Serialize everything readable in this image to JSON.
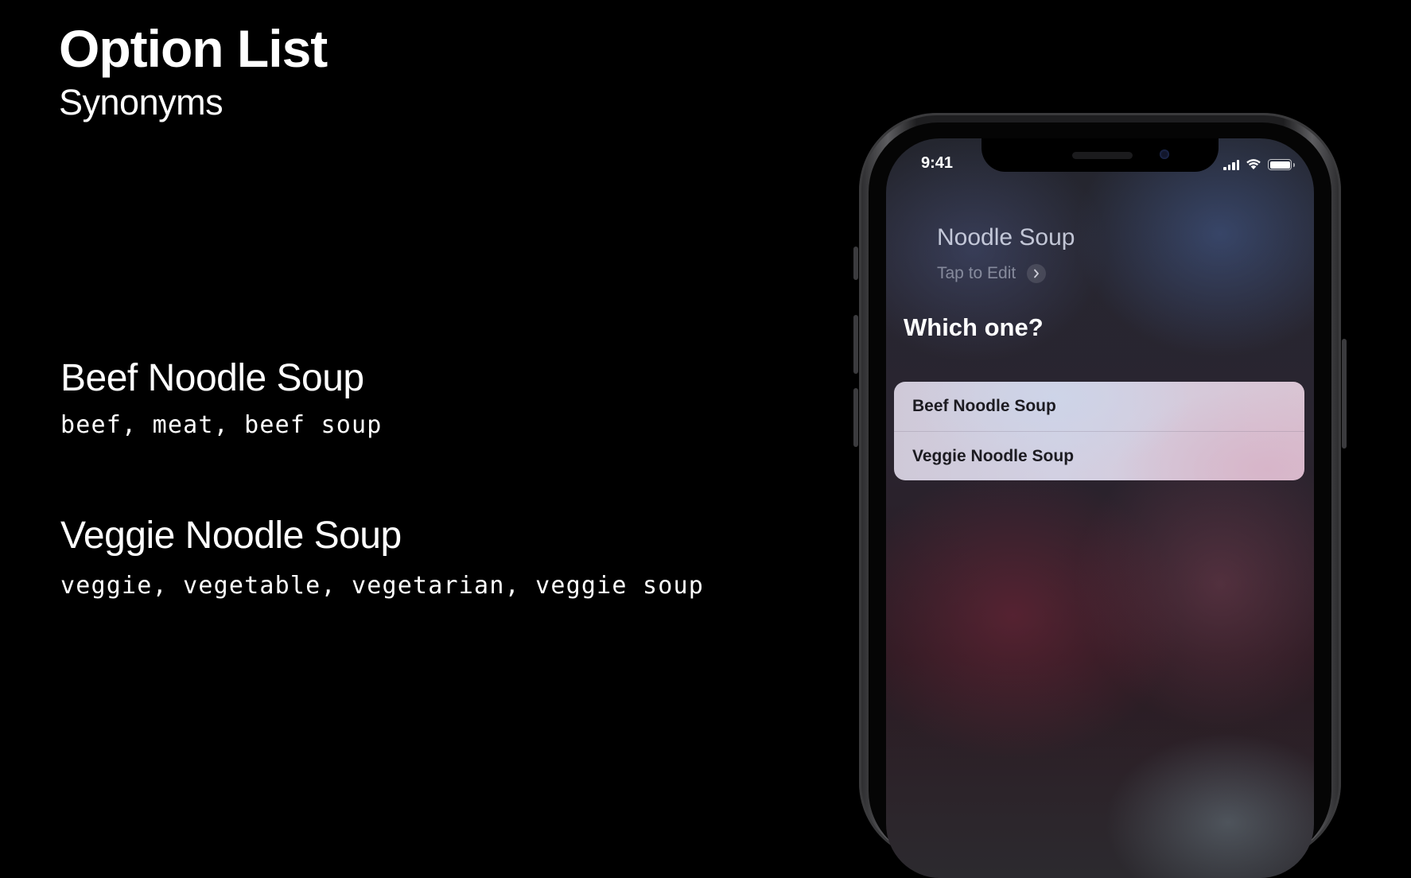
{
  "slide": {
    "title": "Option List",
    "subtitle": "Synonyms"
  },
  "options": [
    {
      "name": "Beef Noodle Soup",
      "synonyms": "beef, meat, beef soup"
    },
    {
      "name": "Veggie Noodle Soup",
      "synonyms": "veggie, vegetable, vegetarian, veggie soup"
    }
  ],
  "phone": {
    "status_time": "9:41",
    "status_icons": [
      "cellular-signal-icon",
      "wifi-icon",
      "battery-icon"
    ],
    "query": "Noodle Soup",
    "tap_to_edit": "Tap to Edit",
    "prompt": "Which one?",
    "choices": [
      "Beef Noodle Soup",
      "Veggie Noodle Soup"
    ]
  }
}
